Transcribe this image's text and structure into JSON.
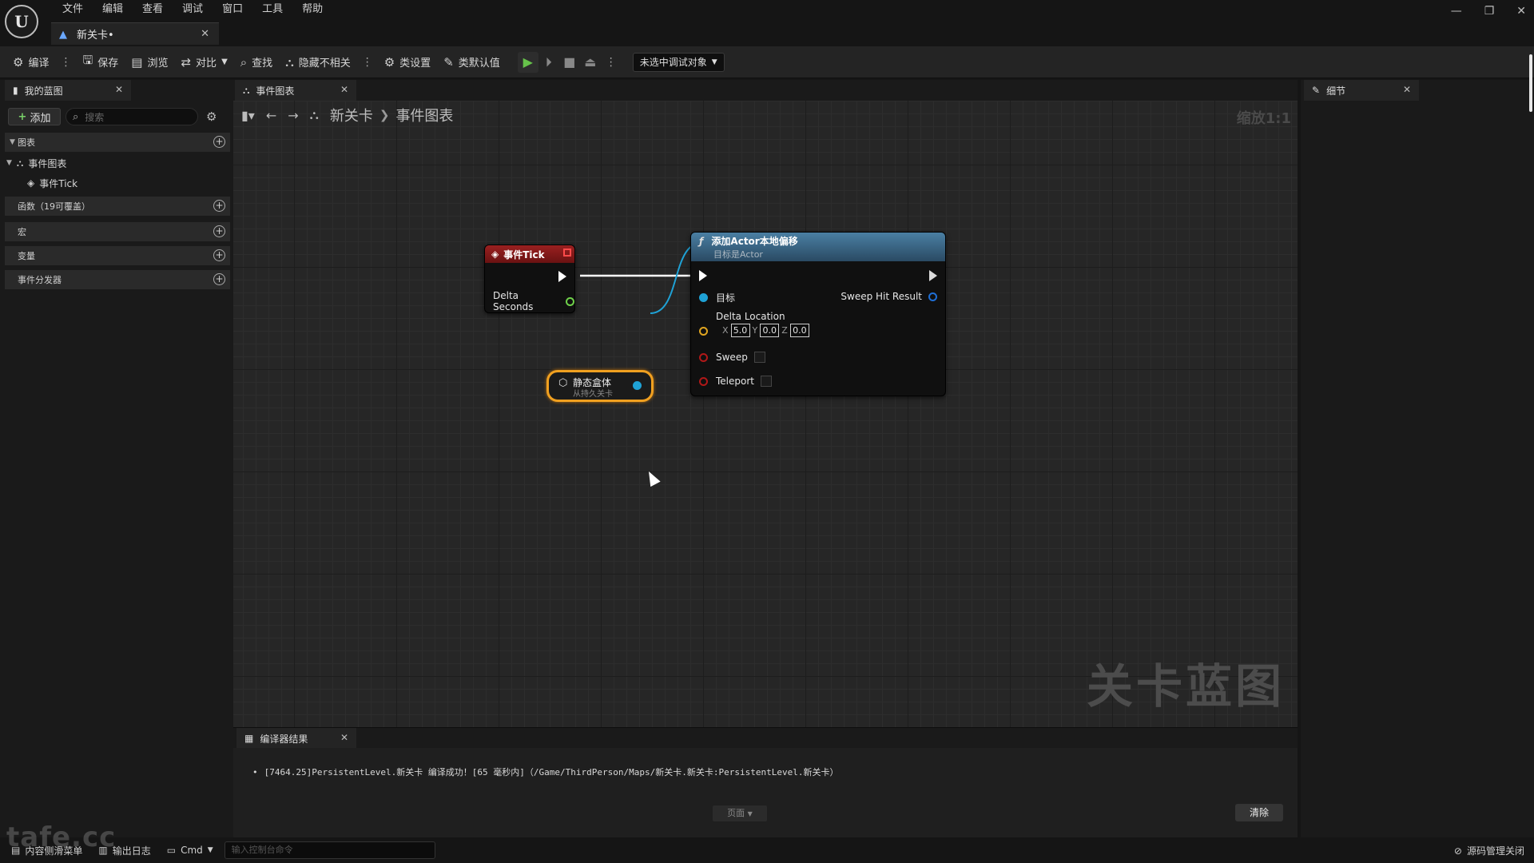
{
  "menu": [
    "文件",
    "编辑",
    "查看",
    "调试",
    "窗口",
    "工具",
    "帮助"
  ],
  "doc_tab": {
    "label": "新关卡•"
  },
  "toolbar": {
    "compile": "编译",
    "save": "保存",
    "browse": "浏览",
    "diff": "对比",
    "find": "查找",
    "hide_unrelated": "隐藏不相关",
    "class_settings": "类设置",
    "class_defaults": "类默认值",
    "debug_select": "未选中调试对象"
  },
  "left_panel": {
    "tab": "我的蓝图",
    "add_label": "添加",
    "search_placeholder": "搜索",
    "sections": {
      "graphs": "图表",
      "event_graph": "事件图表",
      "event_tick": "事件Tick",
      "functions": "函数（19可覆盖）",
      "macros": "宏",
      "variables": "变量",
      "dispatchers": "事件分发器"
    }
  },
  "graph": {
    "tab": "事件图表",
    "breadcrumb": [
      "新关卡",
      "事件图表"
    ],
    "zoom": "缩放1:1",
    "watermark": "关卡蓝图"
  },
  "nodes": {
    "event_tick": {
      "title": "事件Tick",
      "pin_delta": "Delta Seconds"
    },
    "static_mesh": {
      "title": "静态盒体",
      "subtitle": "从持久关卡"
    },
    "add_offset": {
      "title": "添加Actor本地偏移",
      "subtitle": "目标是Actor",
      "pin_target": "目标",
      "pin_sweep_hit": "Sweep Hit Result",
      "pin_delta_location": "Delta Location",
      "x_label": "X",
      "x": "5.0",
      "y_label": "Y",
      "y": "0.0",
      "z_label": "Z",
      "z": "0.0",
      "pin_sweep": "Sweep",
      "pin_teleport": "Teleport"
    }
  },
  "compiler": {
    "tab": "编译器结果",
    "message": "[7464.25]PersistentLevel.新关卡 编译成功！[65 毫秒内]（/Game/ThirdPerson/Maps/新关卡.新关卡:PersistentLevel.新关卡）",
    "page_label": "页面",
    "clear_label": "清除"
  },
  "right_panel": {
    "tab": "细节"
  },
  "statusbar": {
    "content_drawer": "内容侧滑菜单",
    "output_log": "输出日志",
    "cmd": "Cmd",
    "console_placeholder": "输入控制台命令",
    "source_control": "源码管理关闭"
  },
  "corner_logo": "tafe.cc",
  "colors": {
    "event_header": "#8a1c1c",
    "function_header": "#3f6f8f",
    "exec_wire": "#ffffff",
    "object_wire": "#1fa2d6",
    "struct_pin": "#e0a520",
    "bool_pin": "#9a1414",
    "float_pin": "#6fd14a",
    "selection": "#f0a020"
  }
}
